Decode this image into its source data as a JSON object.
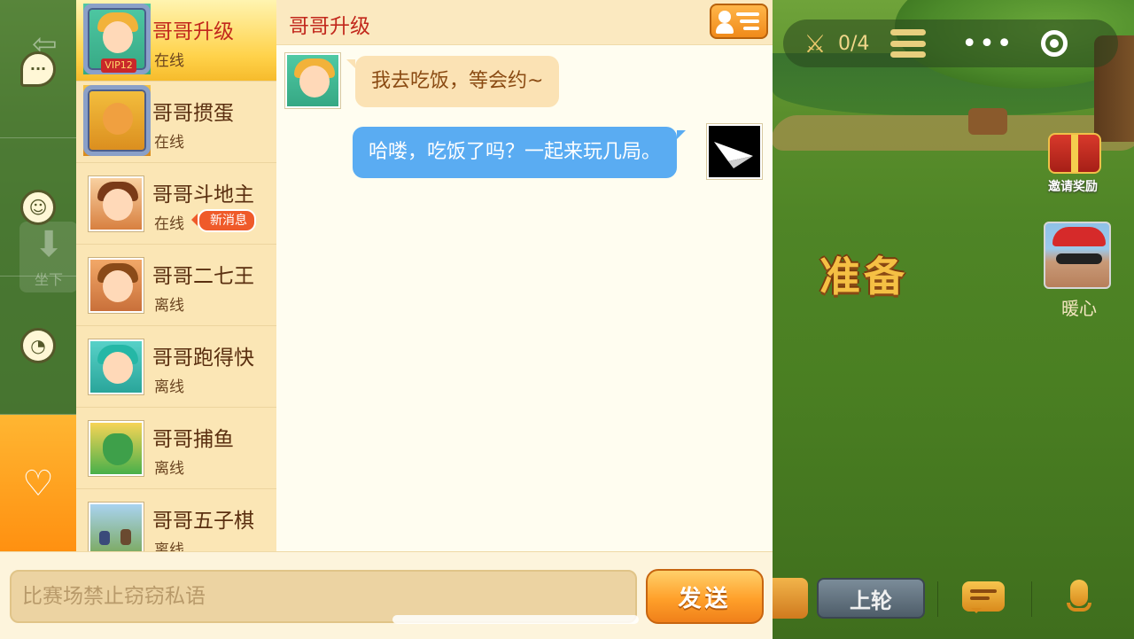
{
  "game": {
    "battle_count": "0/4",
    "invite_reward_label": "邀请奖励",
    "ready_label": "准备",
    "player_name": "暖心",
    "last_round_label": "上轮",
    "sit_down_label": "坐下"
  },
  "friends": [
    {
      "name": "哥哥升级",
      "status": "在线",
      "vip": "VIP12",
      "selected": true
    },
    {
      "name": "哥哥掼蛋",
      "status": "在线"
    },
    {
      "name": "哥哥斗地主",
      "status": "在线",
      "badge": "新消息"
    },
    {
      "name": "哥哥二七王",
      "status": "离线"
    },
    {
      "name": "哥哥跑得快",
      "status": "离线"
    },
    {
      "name": "哥哥捕鱼",
      "status": "离线"
    },
    {
      "name": "哥哥五子棋",
      "status": "离线"
    }
  ],
  "chat": {
    "title": "哥哥升级",
    "messages": [
      {
        "from": "friend",
        "text": "我去吃饭，等会约~"
      },
      {
        "from": "me",
        "text": "哈喽，吃饭了吗？一起来玩几局。"
      }
    ]
  },
  "input": {
    "placeholder": "比赛场禁止窃窃私语",
    "value": "",
    "send_label": "发送"
  },
  "colors": {
    "accent_orange": "#ffa02a",
    "bubble_out": "#5aacf2",
    "bubble_in": "#fbe2b4",
    "title_red": "#c2281c"
  },
  "icons": [
    "back-arrow-icon",
    "chat-bubble-icon",
    "emoji-icon",
    "clock-icon",
    "friends-heart-icon",
    "profile-list-icon",
    "crossed-swords-icon",
    "menu-icon",
    "more-dots-icon",
    "target-icon",
    "gift-icon",
    "chat-icon",
    "microphone-icon",
    "paper-plane-icon"
  ]
}
